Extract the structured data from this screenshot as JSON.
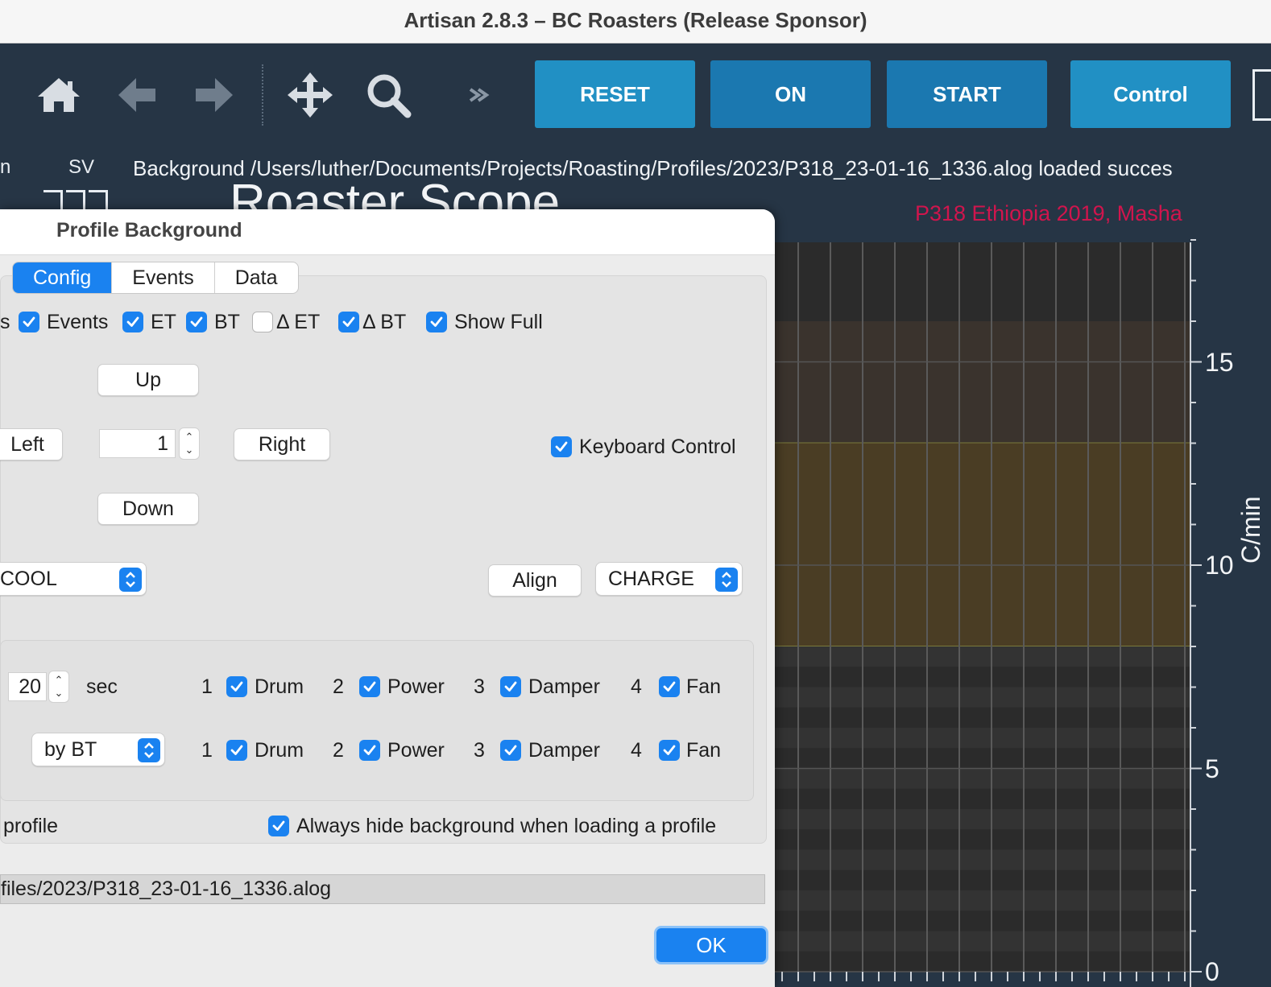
{
  "window": {
    "title": "Artisan 2.8.3 – BC Roasters (Release Sponsor)"
  },
  "toolbar": {
    "icons": [
      "home-icon",
      "back-arrow-icon",
      "forward-arrow-icon",
      "pan-move-icon",
      "zoom-search-icon",
      "more-chevron-icon"
    ],
    "buttons": {
      "reset": "RESET",
      "on": "ON",
      "start": "START",
      "control": "Control"
    }
  },
  "status": {
    "left_partial": "n",
    "sv_label": "SV",
    "message": "Background /Users/luther/Documents/Projects/Roasting/Profiles/2023/P318_23-01-16_1336.alog loaded succes"
  },
  "chart": {
    "title_partial": "Roaster Scope",
    "background_profile_title": "P318 Ethiopia 2019, Masha",
    "subtitle_color": "#d0154d"
  },
  "chart_data": {
    "type": "line",
    "ylabel": "C/min",
    "ylim": [
      0,
      18
    ],
    "yticks": [
      "0",
      "5",
      "10",
      "15"
    ],
    "bands": [
      {
        "from": 13,
        "to": 16,
        "color": "#3a332d"
      },
      {
        "from": 8,
        "to": 13,
        "color": "#4a3d24"
      }
    ],
    "series": []
  },
  "dialog": {
    "title": "Profile Background",
    "tabs": [
      "Config",
      "Events",
      "Data"
    ],
    "active_tab": "Config",
    "show_row": [
      {
        "label": "Events",
        "checked": true
      },
      {
        "label": "ET",
        "checked": true
      },
      {
        "label": "BT",
        "checked": true
      },
      {
        "label": "Δ ET",
        "checked": false
      },
      {
        "label": "Δ BT",
        "checked": true
      },
      {
        "label": "Show Full",
        "checked": true
      }
    ],
    "show_row_partial": "s",
    "move": {
      "up": "Up",
      "down": "Down",
      "left": "Left",
      "right": "Right",
      "step": "1"
    },
    "keyboard_control": {
      "label": "Keyboard Control",
      "checked": true
    },
    "align": {
      "event_select": "COOL",
      "button": "Align",
      "target_select": "CHARGE"
    },
    "replay": {
      "seconds_value": "20",
      "seconds_unit": "sec",
      "mode_select": "by BT",
      "events_row1": [
        {
          "num": "1",
          "label": "Drum",
          "checked": true
        },
        {
          "num": "2",
          "label": "Power",
          "checked": true
        },
        {
          "num": "3",
          "label": "Damper",
          "checked": true
        },
        {
          "num": "4",
          "label": "Fan",
          "checked": true
        }
      ],
      "events_row2": [
        {
          "num": "1",
          "label": "Drum",
          "checked": true
        },
        {
          "num": "2",
          "label": "Power",
          "checked": true
        },
        {
          "num": "3",
          "label": "Damper",
          "checked": true
        },
        {
          "num": "4",
          "label": "Fan",
          "checked": true
        }
      ]
    },
    "profile_partial": "profile",
    "always_hide": {
      "label": "Always hide background when loading a profile",
      "checked": true
    },
    "path": "files/2023/P318_23-01-16_1336.alog",
    "ok": "OK"
  },
  "colors": {
    "accent": "#1a82f0",
    "toolbar_button": "#2190c4",
    "app_background": "#263545"
  }
}
